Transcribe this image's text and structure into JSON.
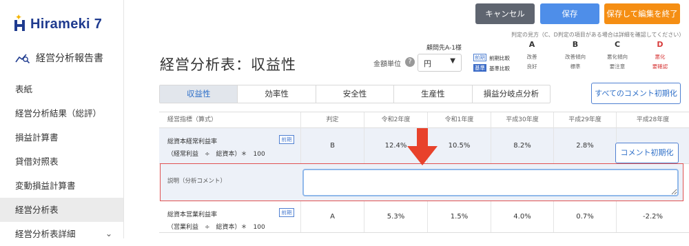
{
  "sidebar": {
    "logo_text": "Hirameki 7",
    "report_title": "経営分析報告書",
    "items": [
      {
        "label": "表紙"
      },
      {
        "label": "経営分析結果（総評）"
      },
      {
        "label": "損益計算書"
      },
      {
        "label": "貸借対照表"
      },
      {
        "label": "変動損益計算書"
      },
      {
        "label": "経営分析表"
      },
      {
        "label": "経営分析表詳細"
      }
    ]
  },
  "toolbar": {
    "cancel_label": "キャンセル",
    "save_label": "保存",
    "save_exit_label": "保存して編集を終了"
  },
  "header": {
    "page_title": "経営分析表：収益性",
    "unit_label": "金額単位",
    "unit_value": "円",
    "client_name": "顧問先A-1様",
    "compare": {
      "prev_tag": "前期",
      "prev_label": "前期比較",
      "base_tag": "基準",
      "base_label": "基準比較"
    },
    "legend": {
      "title": "判定の見方（C、D判定の項目がある場合は詳細を確認してください）",
      "columns": [
        {
          "letter": "A",
          "prev": "改善",
          "base": "良好"
        },
        {
          "letter": "B",
          "prev": "改善傾向",
          "base": "標準"
        },
        {
          "letter": "C",
          "prev": "悪化傾向",
          "base": "要注意"
        },
        {
          "letter": "D",
          "prev": "悪化",
          "base": "要確認"
        }
      ],
      "red_color": "#d73a3a"
    }
  },
  "tabs": [
    {
      "label": "収益性"
    },
    {
      "label": "効率性"
    },
    {
      "label": "安全性"
    },
    {
      "label": "生産性"
    },
    {
      "label": "損益分岐点分析"
    }
  ],
  "reset_all_label": "すべてのコメント初期化",
  "table": {
    "headers": [
      "経営指標（算式）",
      "判定",
      "令和2年度",
      "令和1年度",
      "平成30年度",
      "平成29年度",
      "平成28年度"
    ],
    "rows": [
      {
        "name": "総資本経常利益率",
        "formula": "（経常利益　÷　総資本）＊　100",
        "tag": "前期",
        "grade": "B",
        "values": [
          "12.4%",
          "10.5%",
          "8.2%",
          "2.8%",
          ""
        ]
      },
      {
        "name": "総資本営業利益率",
        "formula": "（営業利益　÷　総資本）＊　100",
        "tag": "前期",
        "grade": "A",
        "values": [
          "5.3%",
          "1.5%",
          "4.0%",
          "0.7%",
          "-2.2%"
        ]
      }
    ],
    "comment_label": "説明（分析コメント）",
    "comment_value": ""
  },
  "reset_comment_label": "コメント初期化",
  "colors": {
    "accent": "#4e8ee9",
    "cancel": "#5f6570",
    "save_exit": "#f58e13",
    "annotation_arrow": "#e8422b",
    "annotation_box": "#e05050"
  }
}
